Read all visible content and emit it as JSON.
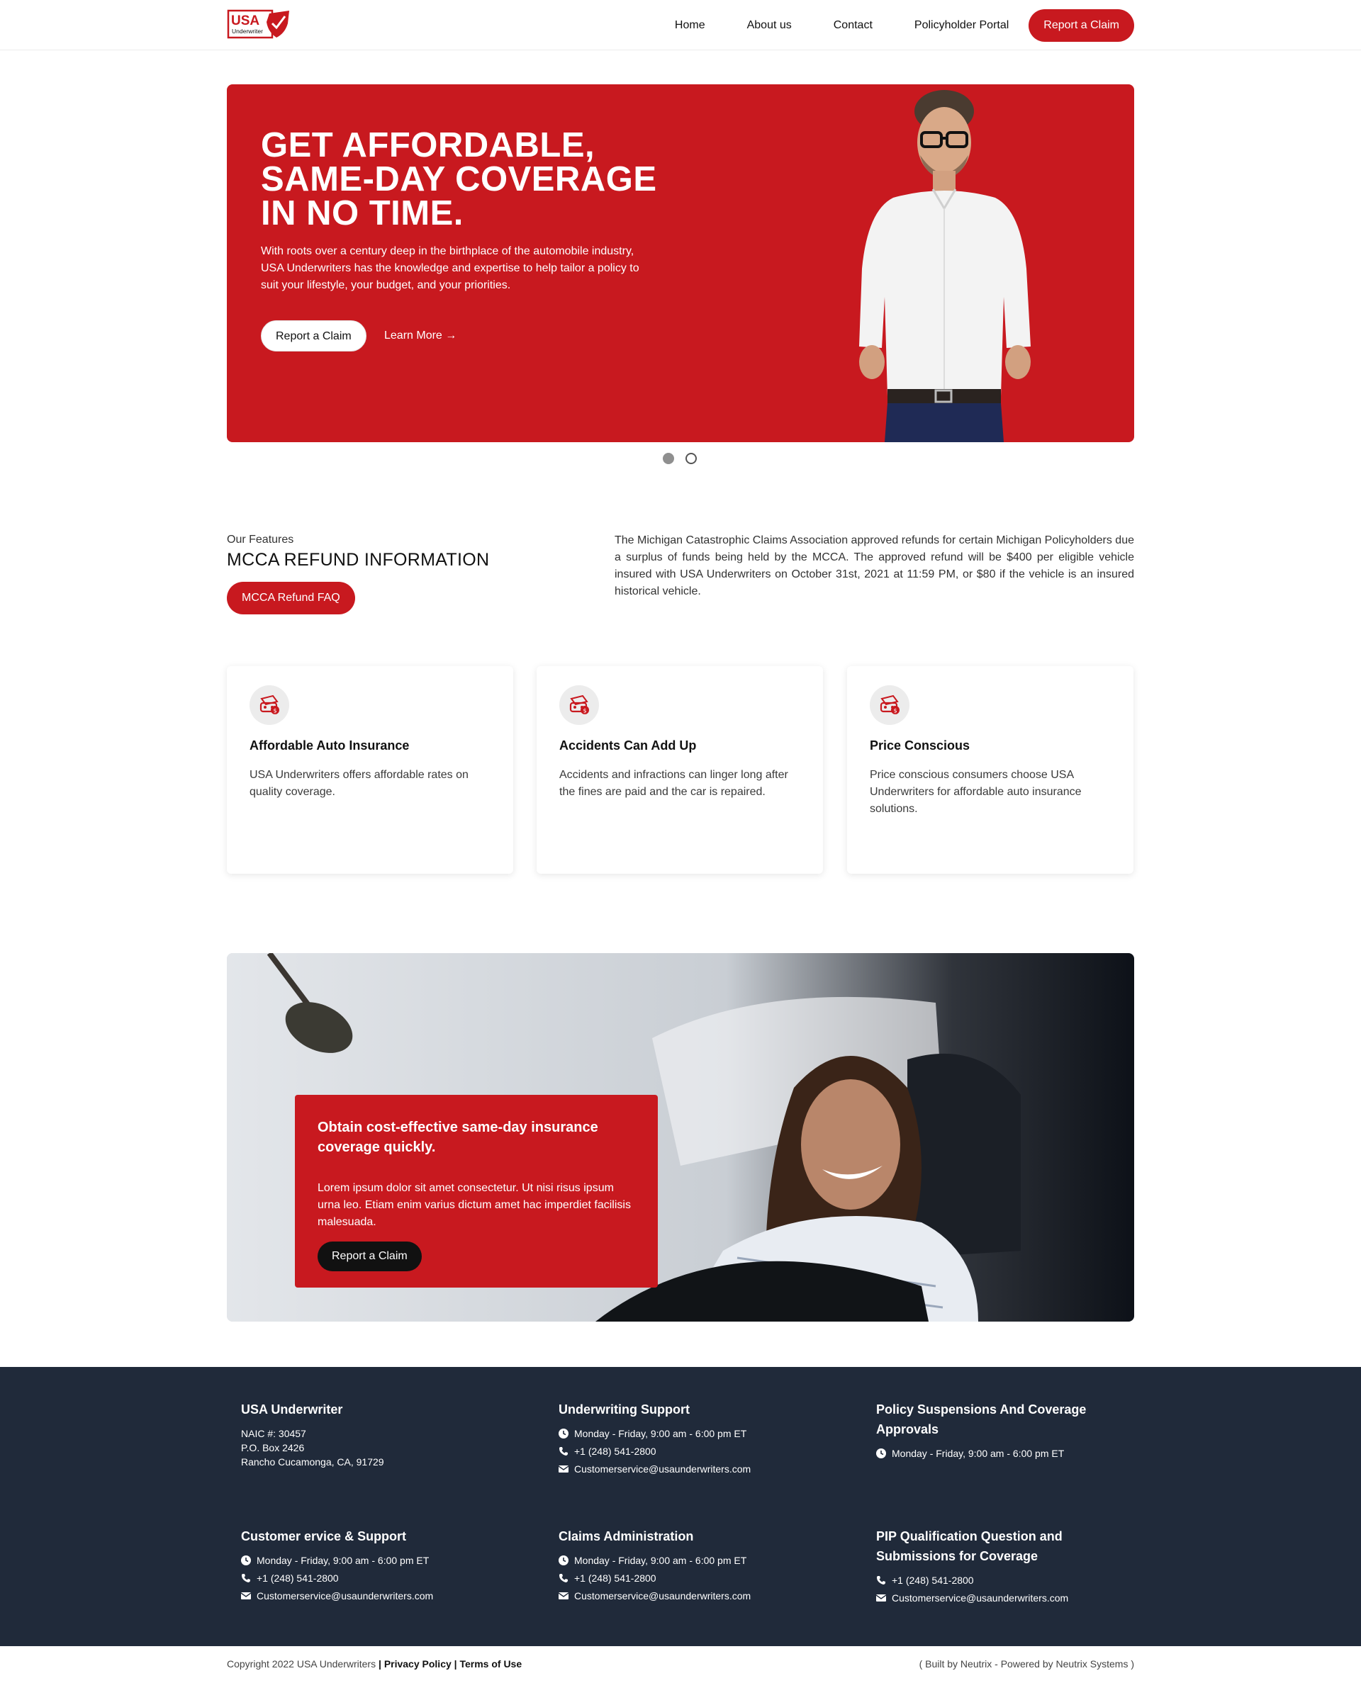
{
  "header": {
    "logo_text": "USA",
    "logo_subtext": "Underwriter",
    "nav": [
      "Home",
      "About us",
      "Contact",
      "Policyholder Portal"
    ],
    "cta": "Report a Claim"
  },
  "hero": {
    "title_lines": [
      "GET AFFORDABLE,",
      "SAME-DAY COVERAGE",
      "IN NO TIME."
    ],
    "text": "With roots over a century deep in the birthplace of the automobile industry, USA Underwriters has the knowledge and expertise to help tailor a policy to suit your lifestyle, your budget, and your priorities.",
    "primary_button": "Report a Claim",
    "secondary_link": "Learn More →"
  },
  "features": {
    "eyebrow": "Our Features",
    "title": "MCCA REFUND INFORMATION",
    "button": "MCCA Refund FAQ",
    "description": "The Michigan Catastrophic Claims Association approved refunds for certain Michigan Policyholders due a surplus of funds being held by the MCCA. The approved refund will be $400 per eligible vehicle insured with USA Underwriters on October 31st, 2021 at 11:59 PM, or $80 if the vehicle is an insured historical vehicle."
  },
  "cards": [
    {
      "title": "Affordable Auto Insurance",
      "text": "USA Underwriters offers affordable rates on quality coverage.",
      "icon": "car-money-icon"
    },
    {
      "title": "Accidents Can Add Up",
      "text": "Accidents and infractions can linger long after the fines are paid and the car is repaired.",
      "icon": "car-money-icon"
    },
    {
      "title": "Price Conscious",
      "text": "Price conscious consumers choose USA Underwriters for affordable auto insurance solutions.",
      "icon": "car-money-icon"
    }
  ],
  "banner": {
    "title": "Obtain cost-effective same-day insurance coverage quickly.",
    "text": "Lorem ipsum dolor sit amet consectetur. Ut nisi risus ipsum urna leo. Etiam enim varius dictum amet hac imperdiet facilisis malesuada.",
    "button": "Report a Claim"
  },
  "footer": {
    "company": {
      "title": "USA Underwriter",
      "naic": "NAIC #: 30457",
      "box": "P.O. Box 2426",
      "city": "Rancho Cucamonga, CA, 91729"
    },
    "underwriting": {
      "title": "Underwriting Support",
      "hours": "Monday - Friday, 9:00 am - 6:00 pm ET",
      "phone": "+1 (248) 541-2800",
      "email": "Customerservice@usaunderwriters.com"
    },
    "suspensions": {
      "title": "Policy Suspensions And Coverage Approvals",
      "hours": "Monday - Friday, 9:00 am - 6:00 pm ET"
    },
    "customer": {
      "title": "Customer ervice & Support",
      "hours": "Monday - Friday, 9:00 am - 6:00 pm ET",
      "phone": "+1 (248) 541-2800",
      "email": "Customerservice@usaunderwriters.com"
    },
    "claims": {
      "title": "Claims Administration",
      "hours": "Monday - Friday, 9:00 am - 6:00 pm ET",
      "phone": "+1 (248) 541-2800",
      "email": "Customerservice@usaunderwriters.com"
    },
    "pip": {
      "title": "PIP Qualification Question and Submissions for Coverage",
      "phone": "+1 (248) 541-2800",
      "email": "Customerservice@usaunderwriters.com"
    }
  },
  "bottom": {
    "copyright": "Copyright 2022 USA Underwriters",
    "privacy": "Privacy Policy",
    "terms": "Terms of Use",
    "built": "( Built by Neutrix - Powered by Neutrix Systems )"
  },
  "colors": {
    "brand_red": "#c8191f",
    "footer_bg": "#202a3a"
  }
}
